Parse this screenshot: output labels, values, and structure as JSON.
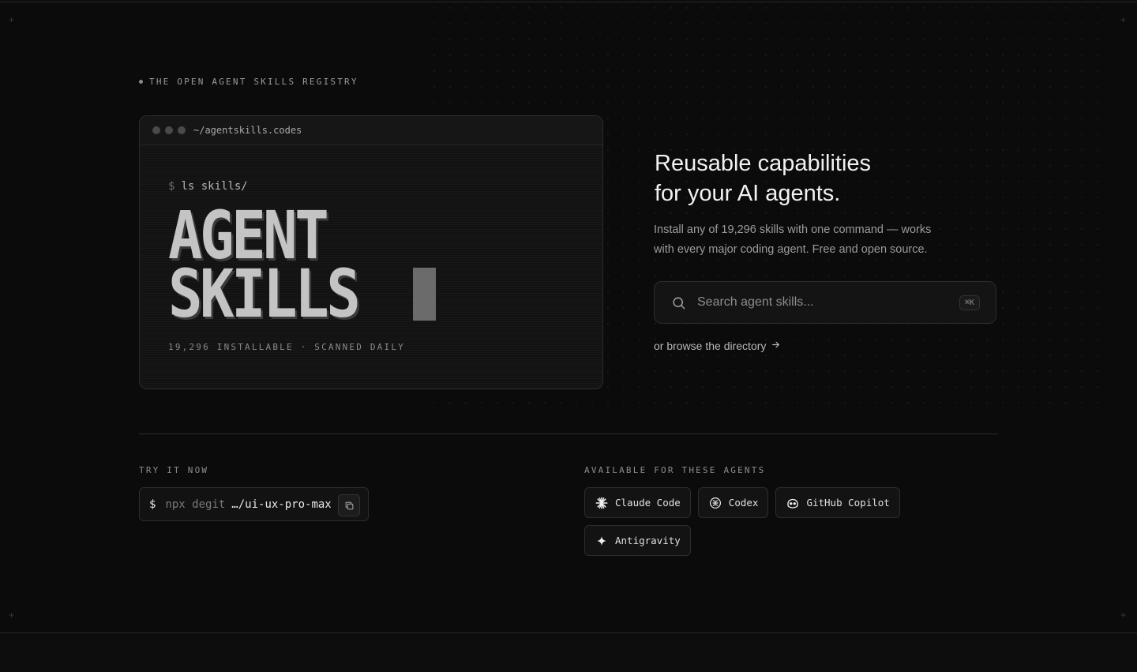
{
  "eyebrow": "THE OPEN AGENT SKILLS REGISTRY",
  "terminal": {
    "path": "~/agentskills.codes",
    "prompt_symbol": "$",
    "command": "ls skills/",
    "title_line1": "AGENT",
    "title_line2": "SKILLS",
    "stats": "19,296 INSTALLABLE · SCANNED DAILY"
  },
  "hero": {
    "headline_line1": "Reusable capabilities",
    "headline_line2": "for your AI agents.",
    "subtitle_line1": "Install any of 19,296 skills with one command — works",
    "subtitle_line2": "with every major coding agent. Free and open source."
  },
  "search": {
    "placeholder": "Search agent skills...",
    "shortcut": "⌘K",
    "icon": "search-icon"
  },
  "browse_link": {
    "label": "or browse the directory",
    "icon": "arrow-right-icon"
  },
  "try_it": {
    "label": "TRY IT NOW",
    "prompt_symbol": "$",
    "command_prefix": "npx degit",
    "command_target": "…/ui-ux-pro-max",
    "copy_icon": "copy-icon"
  },
  "agents_section": {
    "label": "AVAILABLE FOR THESE AGENTS",
    "agents": [
      {
        "name": "Claude Code",
        "icon": "claude-icon"
      },
      {
        "name": "Codex",
        "icon": "openai-icon"
      },
      {
        "name": "GitHub Copilot",
        "icon": "copilot-icon"
      },
      {
        "name": "Antigravity",
        "icon": "sparkle-icon"
      }
    ]
  },
  "colors": {
    "background": "#0b0b0b",
    "text": "#e8e8e8",
    "muted": "#8d8d8d",
    "border": "#2d2d2d"
  }
}
